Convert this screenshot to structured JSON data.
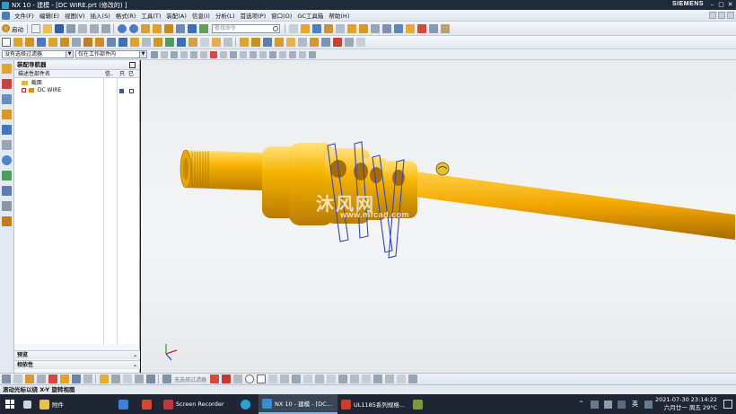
{
  "titlebar": {
    "title": "NX 10 - 建模 - [DC WIRE.prt  (修改的)  ]",
    "brand": "SIEMENS",
    "minimize": "–",
    "maximize": "▢",
    "close": "✕"
  },
  "menubar": {
    "items": [
      "文件(F)",
      "编辑(E)",
      "视图(V)",
      "插入(S)",
      "格式(R)",
      "工具(T)",
      "装配(A)",
      "信息(I)",
      "分析(L)",
      "首选项(P)",
      "窗口(O)",
      "GC工具箱",
      "帮助(H)"
    ]
  },
  "toolbar": {
    "start_label": "启动",
    "search_placeholder": "查找命令"
  },
  "filterbar": {
    "filter_value": "没有选择过滤器",
    "scope_value": "仅在工作部件内"
  },
  "navigator": {
    "title": "装配导航器",
    "columns": {
      "name": "描述性部件名",
      "info": "信..",
      "r": "只",
      "m": "已"
    },
    "rows": [
      {
        "label": "截面"
      },
      {
        "label": "DC WIRE"
      }
    ],
    "panels": {
      "preview": "预览",
      "dependencies": "相依性"
    }
  },
  "watermark": {
    "text": "沐风网",
    "url": "www.mfcad.com"
  },
  "bottombar": {
    "filter_text": "无选择过滤器"
  },
  "status": {
    "text": "滚动光标以绕 X-Y 旋转视图"
  },
  "taskbar": {
    "apps": [
      {
        "label": "",
        "icon": "task-view-icon",
        "color": "#cfd6df"
      },
      {
        "label": "附件",
        "icon": "folder-icon",
        "color": "#e8c04a"
      },
      {
        "label": "",
        "icon": "store-icon",
        "color": "#3d7fd9"
      },
      {
        "label": "",
        "icon": "app-icon",
        "color": "#d9452f"
      },
      {
        "label": "Screen Recorder",
        "icon": "screen-recorder-icon",
        "color": "#c8343b"
      },
      {
        "label": "",
        "icon": "edge-icon",
        "color": "#2aa1d8"
      },
      {
        "label": "NX 10 - 建模 - [DC...",
        "icon": "nx-icon",
        "color": "#3b8ed0",
        "active": true
      },
      {
        "label": "UL1185系列规格...",
        "icon": "pdf-icon",
        "color": "#d43a2a"
      },
      {
        "label": "",
        "icon": "app-icon",
        "color": "#7b9a3c"
      }
    ],
    "tray": {
      "ime": "英",
      "date": "2021-07-30 23:14:22",
      "weather": "六月廿一 周五 29°C"
    }
  },
  "colors": {
    "part": "#f7b500",
    "part_dark": "#b77a00",
    "sketch": "#3344cc"
  }
}
